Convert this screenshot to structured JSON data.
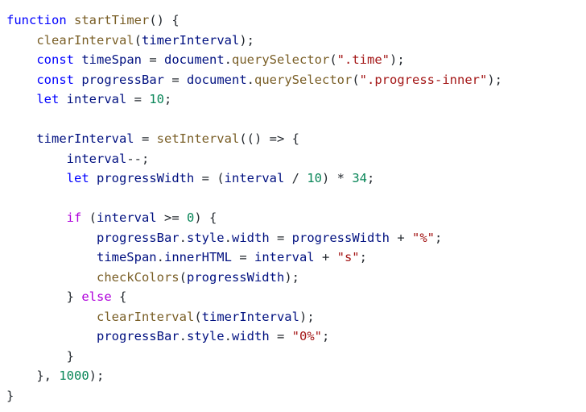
{
  "editor": {
    "background": "#ffffff",
    "colors": {
      "keyword": "#0000ff",
      "control": "#af00db",
      "function": "#795e26",
      "variable": "#001080",
      "string": "#a31515",
      "number": "#098658",
      "punctuation": "#24292f"
    },
    "lines": [
      {
        "indent": 0,
        "tokens": [
          {
            "t": "function",
            "k": "keyword"
          },
          {
            "t": " ",
            "k": "punct"
          },
          {
            "t": "startTimer",
            "k": "function"
          },
          {
            "t": "() {",
            "k": "punct"
          }
        ]
      },
      {
        "indent": 1,
        "tokens": [
          {
            "t": "clearInterval",
            "k": "function"
          },
          {
            "t": "(",
            "k": "punct"
          },
          {
            "t": "timerInterval",
            "k": "variable"
          },
          {
            "t": ");",
            "k": "punct"
          }
        ]
      },
      {
        "indent": 1,
        "tokens": [
          {
            "t": "const",
            "k": "keyword"
          },
          {
            "t": " ",
            "k": "punct"
          },
          {
            "t": "timeSpan",
            "k": "variable"
          },
          {
            "t": " = ",
            "k": "operator"
          },
          {
            "t": "document",
            "k": "variable"
          },
          {
            "t": ".",
            "k": "punct"
          },
          {
            "t": "querySelector",
            "k": "function"
          },
          {
            "t": "(",
            "k": "punct"
          },
          {
            "t": "\".time\"",
            "k": "string"
          },
          {
            "t": ");",
            "k": "punct"
          }
        ]
      },
      {
        "indent": 1,
        "tokens": [
          {
            "t": "const",
            "k": "keyword"
          },
          {
            "t": " ",
            "k": "punct"
          },
          {
            "t": "progressBar",
            "k": "variable"
          },
          {
            "t": " = ",
            "k": "operator"
          },
          {
            "t": "document",
            "k": "variable"
          },
          {
            "t": ".",
            "k": "punct"
          },
          {
            "t": "querySelector",
            "k": "function"
          },
          {
            "t": "(",
            "k": "punct"
          },
          {
            "t": "\".progress-inner\"",
            "k": "string"
          },
          {
            "t": ");",
            "k": "punct"
          }
        ]
      },
      {
        "indent": 1,
        "tokens": [
          {
            "t": "let",
            "k": "keyword"
          },
          {
            "t": " ",
            "k": "punct"
          },
          {
            "t": "interval",
            "k": "variable"
          },
          {
            "t": " = ",
            "k": "operator"
          },
          {
            "t": "10",
            "k": "number"
          },
          {
            "t": ";",
            "k": "punct"
          }
        ]
      },
      {
        "indent": 0,
        "tokens": []
      },
      {
        "indent": 1,
        "tokens": [
          {
            "t": "timerInterval",
            "k": "variable"
          },
          {
            "t": " = ",
            "k": "operator"
          },
          {
            "t": "setInterval",
            "k": "function"
          },
          {
            "t": "(() => {",
            "k": "punct"
          }
        ]
      },
      {
        "indent": 2,
        "tokens": [
          {
            "t": "interval",
            "k": "variable"
          },
          {
            "t": "--;",
            "k": "punct"
          }
        ]
      },
      {
        "indent": 2,
        "tokens": [
          {
            "t": "let",
            "k": "keyword"
          },
          {
            "t": " ",
            "k": "punct"
          },
          {
            "t": "progressWidth",
            "k": "variable"
          },
          {
            "t": " = (",
            "k": "operator"
          },
          {
            "t": "interval",
            "k": "variable"
          },
          {
            "t": " / ",
            "k": "operator"
          },
          {
            "t": "10",
            "k": "number"
          },
          {
            "t": ") * ",
            "k": "operator"
          },
          {
            "t": "34",
            "k": "number"
          },
          {
            "t": ";",
            "k": "punct"
          }
        ]
      },
      {
        "indent": 0,
        "tokens": []
      },
      {
        "indent": 2,
        "tokens": [
          {
            "t": "if",
            "k": "control"
          },
          {
            "t": " (",
            "k": "punct"
          },
          {
            "t": "interval",
            "k": "variable"
          },
          {
            "t": " >= ",
            "k": "operator"
          },
          {
            "t": "0",
            "k": "number"
          },
          {
            "t": ") {",
            "k": "punct"
          }
        ]
      },
      {
        "indent": 3,
        "tokens": [
          {
            "t": "progressBar",
            "k": "variable"
          },
          {
            "t": ".",
            "k": "punct"
          },
          {
            "t": "style",
            "k": "variable"
          },
          {
            "t": ".",
            "k": "punct"
          },
          {
            "t": "width",
            "k": "variable"
          },
          {
            "t": " = ",
            "k": "operator"
          },
          {
            "t": "progressWidth",
            "k": "variable"
          },
          {
            "t": " + ",
            "k": "operator"
          },
          {
            "t": "\"%\"",
            "k": "string"
          },
          {
            "t": ";",
            "k": "punct"
          }
        ]
      },
      {
        "indent": 3,
        "tokens": [
          {
            "t": "timeSpan",
            "k": "variable"
          },
          {
            "t": ".",
            "k": "punct"
          },
          {
            "t": "innerHTML",
            "k": "variable"
          },
          {
            "t": " = ",
            "k": "operator"
          },
          {
            "t": "interval",
            "k": "variable"
          },
          {
            "t": " + ",
            "k": "operator"
          },
          {
            "t": "\"s\"",
            "k": "string"
          },
          {
            "t": ";",
            "k": "punct"
          }
        ]
      },
      {
        "indent": 3,
        "tokens": [
          {
            "t": "checkColors",
            "k": "function"
          },
          {
            "t": "(",
            "k": "punct"
          },
          {
            "t": "progressWidth",
            "k": "variable"
          },
          {
            "t": ");",
            "k": "punct"
          }
        ]
      },
      {
        "indent": 2,
        "tokens": [
          {
            "t": "} ",
            "k": "punct"
          },
          {
            "t": "else",
            "k": "control"
          },
          {
            "t": " {",
            "k": "punct"
          }
        ]
      },
      {
        "indent": 3,
        "tokens": [
          {
            "t": "clearInterval",
            "k": "function"
          },
          {
            "t": "(",
            "k": "punct"
          },
          {
            "t": "timerInterval",
            "k": "variable"
          },
          {
            "t": ");",
            "k": "punct"
          }
        ]
      },
      {
        "indent": 3,
        "tokens": [
          {
            "t": "progressBar",
            "k": "variable"
          },
          {
            "t": ".",
            "k": "punct"
          },
          {
            "t": "style",
            "k": "variable"
          },
          {
            "t": ".",
            "k": "punct"
          },
          {
            "t": "width",
            "k": "variable"
          },
          {
            "t": " = ",
            "k": "operator"
          },
          {
            "t": "\"0%\"",
            "k": "string"
          },
          {
            "t": ";",
            "k": "punct"
          }
        ]
      },
      {
        "indent": 2,
        "tokens": [
          {
            "t": "}",
            "k": "punct"
          }
        ]
      },
      {
        "indent": 1,
        "tokens": [
          {
            "t": "}, ",
            "k": "punct"
          },
          {
            "t": "1000",
            "k": "number"
          },
          {
            "t": ");",
            "k": "punct"
          }
        ]
      },
      {
        "indent": 0,
        "tokens": [
          {
            "t": "}",
            "k": "punct"
          }
        ]
      }
    ]
  }
}
